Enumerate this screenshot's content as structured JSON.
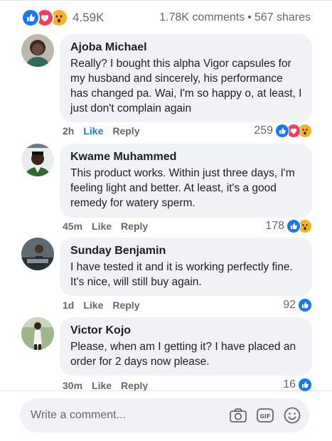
{
  "post_stats": {
    "reaction_icons": [
      "like-icon",
      "love-icon",
      "wow-icon"
    ],
    "reactions_count": "4.59K",
    "comments": "1.78K comments",
    "separator": "•",
    "shares": "567 shares"
  },
  "comments": [
    {
      "author": "Ajoba Michael",
      "text": "Really? I bought this alpha Vigor capsules for my husband and sincerely, his performance has changed pa. Wai, I'm so happy o, at least, I just don't complain again",
      "time": "2h",
      "like_label": "Like",
      "reply_label": "Reply",
      "reaction_count": "259",
      "reactions": [
        "like-icon",
        "love-icon",
        "wow-icon"
      ]
    },
    {
      "author": "Kwame Muhammed",
      "text": "This product works. Within just three days, I'm feeling light and better. At least, it's a good remedy for watery sperm.",
      "time": "45m",
      "like_label": "Like",
      "reply_label": "Reply",
      "reaction_count": "178",
      "reactions": [
        "like-icon",
        "wow-icon"
      ]
    },
    {
      "author": "Sunday Benjamin",
      "text": "I have tested it and it is working perfectly fine. It's nice, will still buy again.",
      "time": "1d",
      "like_label": "Like",
      "reply_label": "Reply",
      "reaction_count": "92",
      "reactions": [
        "like-icon"
      ]
    },
    {
      "author": "Victor Kojo",
      "text": "Please, when am I getting it? I have placed an order for 2 days now please.",
      "time": "30m",
      "like_label": "Like",
      "reply_label": "Reply",
      "reaction_count": "16",
      "reactions": [
        "like-icon"
      ]
    }
  ],
  "composer": {
    "placeholder": "Write a comment...",
    "icons": [
      "camera-icon",
      "gif-icon",
      "emoji-icon"
    ]
  },
  "colors": {
    "accent": "#1877f2",
    "love": "#f33e58",
    "wow": "#f7b125",
    "bubble": "#f0f2f5",
    "muted": "#65676b"
  }
}
